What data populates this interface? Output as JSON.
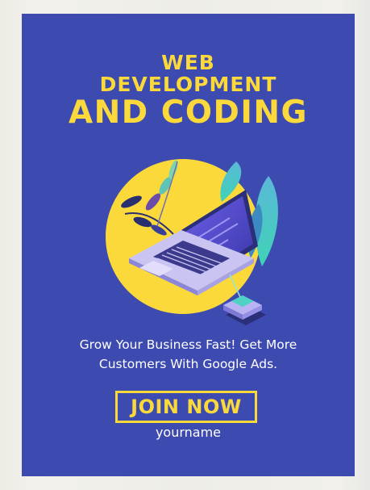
{
  "poster": {
    "title_line1": "WEB",
    "title_line2": "DEVELOPMENT",
    "title_line3": "AND CODING",
    "tagline_line1": "Grow Your Business Fast! Get More",
    "tagline_line2": "Customers With Google Ads.",
    "cta_label": "JOIN NOW",
    "author": "yourname"
  },
  "colors": {
    "background": "#3d4ab0",
    "accent": "#fbd93a",
    "text": "#ffffff"
  },
  "icons": {
    "illustration": "laptop-illustration-icon"
  }
}
